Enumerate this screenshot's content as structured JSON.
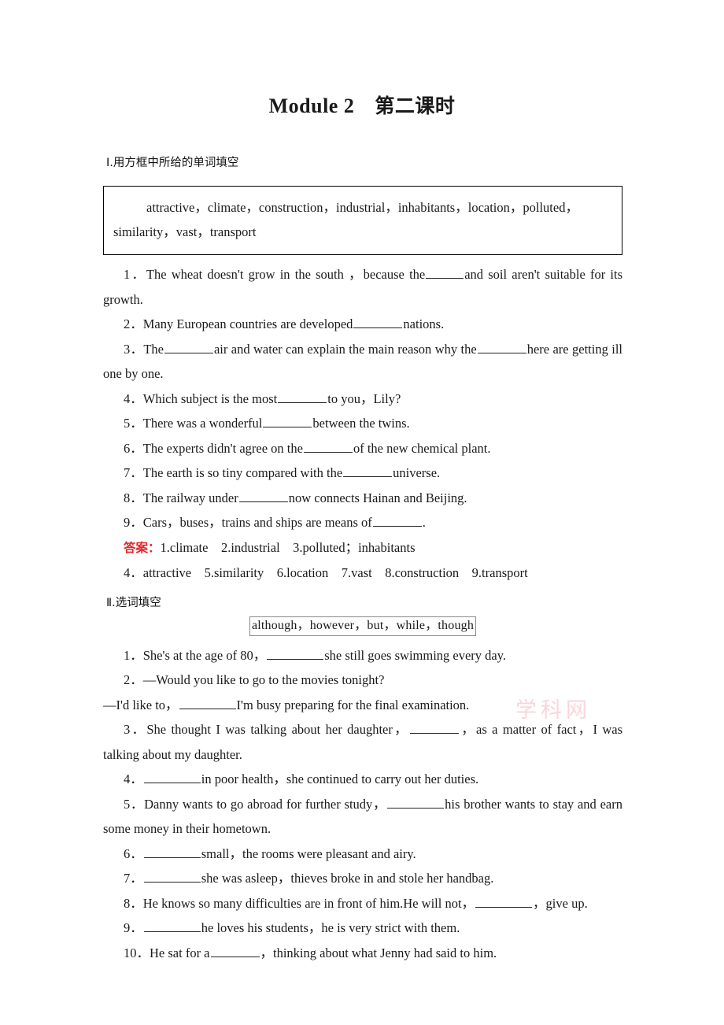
{
  "document": {
    "title_en": "Module 2",
    "title_cn": "第二课时",
    "watermark": "学科网"
  },
  "section_one": {
    "heading": "Ⅰ.用方框中所给的单词填空",
    "wordbox": "attractive，climate，construction，industrial，inhabitants，location，polluted，similarity，vast，transport",
    "questions": [
      {
        "num": "1．",
        "pre": "The wheat doesn't grow in the south ，because the",
        "post": "and soil aren't suitable for its growth.",
        "blank": "small"
      },
      {
        "num": "2．",
        "pre": "Many European countries are developed",
        "post": "nations.",
        "blank": "medium"
      },
      {
        "num": "3．",
        "pre": "The",
        "mid": "air and water can explain the main reason why the",
        "post": "here are getting ill one by one.",
        "blank": "medium"
      },
      {
        "num": "4．",
        "pre": "Which subject is the most",
        "post": "to you，Lily?",
        "blank": "medium"
      },
      {
        "num": "5．",
        "pre": "There was a wonderful",
        "post": "between the twins.",
        "blank": "medium"
      },
      {
        "num": "6．",
        "pre": "The experts didn't agree on the",
        "post": "of the new chemical plant.",
        "blank": "medium"
      },
      {
        "num": "7．",
        "pre": "The earth is so tiny compared with the",
        "post": "universe.",
        "blank": "medium"
      },
      {
        "num": "8．",
        "pre": "The railway under",
        "post": "now connects Hainan and Beijing.",
        "blank": "medium"
      },
      {
        "num": "9．",
        "pre": "Cars，buses，trains and ships are means of",
        "post": ".",
        "blank": "medium"
      }
    ],
    "answer_label": "答案：",
    "answers_line1": "1.climate　2.industrial　3.polluted；inhabitants",
    "answers_line2": "4．attractive　5.similarity　6.location　7.vast　8.construction　9.transport"
  },
  "section_two": {
    "heading": "Ⅱ.选词填空",
    "wordbank": "although，however，but，while，though",
    "questions": [
      {
        "num": "1．",
        "pre": "She's at the age of 80，",
        "post": "she still goes swimming every day."
      },
      {
        "num": "2．",
        "pre": "—Would you like to go to the movies tonight?",
        "post": ""
      },
      {
        "num": "",
        "pre": "—I'd like to，",
        "post": "I'm busy preparing for the final examination."
      },
      {
        "num": "3．",
        "pre": "She thought I was talking about her daughter，",
        "post": "，as a matter of fact，I was talking about my daughter."
      },
      {
        "num": "4．",
        "pre": "",
        "post": "in poor health，she continued to carry out her duties."
      },
      {
        "num": "5．",
        "pre": "Danny wants to go abroad for further study，",
        "post": "his brother wants to stay and earn some money in their hometown."
      },
      {
        "num": "6．",
        "pre": "",
        "post": "small，the rooms were pleasant and airy."
      },
      {
        "num": "7．",
        "pre": "",
        "post": "she was asleep，thieves broke in and stole her handbag."
      },
      {
        "num": "8．",
        "pre": "He knows so many difficulties are in front of him.He will not，",
        "post": "，give up."
      },
      {
        "num": "9．",
        "pre": "",
        "post": "he loves his students，he is very strict with them."
      },
      {
        "num": "10．",
        "pre": "He sat for a",
        "post": "，thinking about what Jenny had said to him."
      }
    ]
  }
}
